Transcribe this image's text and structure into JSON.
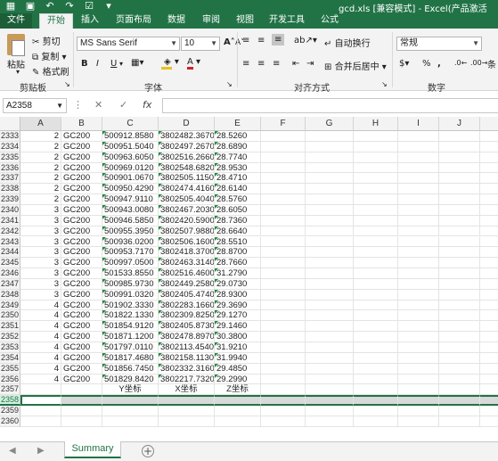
{
  "window": {
    "title": "gcd.xls  [兼容模式] - Excel(产品激活"
  },
  "qat": {
    "save_icon": "save-icon",
    "undo_icon": "undo-icon",
    "redo_icon": "redo-icon"
  },
  "tabs": [
    {
      "label": "文件"
    },
    {
      "label": "开始"
    },
    {
      "label": "插入"
    },
    {
      "label": "页面布局"
    },
    {
      "label": "数据"
    },
    {
      "label": "审阅"
    },
    {
      "label": "视图"
    },
    {
      "label": "开发工具"
    },
    {
      "label": "公式"
    }
  ],
  "ribbon": {
    "clipboard": {
      "paste": "粘贴",
      "cut": "剪切",
      "copy": "复制",
      "format_painter": "格式刷",
      "label": "剪贴板"
    },
    "font": {
      "name": "MS Sans Serif",
      "size": "10",
      "bold": "B",
      "italic": "I",
      "underline": "U",
      "grow": "A",
      "shrink": "A",
      "color_letter": "A",
      "label": "字体",
      "accent_color": "#e8c31b",
      "font_color": "#d0202a"
    },
    "alignment": {
      "wrap": "自动换行",
      "merge": "合并后居中",
      "label": "对齐方式"
    },
    "number": {
      "format": "常规",
      "percent": "%",
      "comma": ",",
      "label": "数字",
      "more": "条"
    }
  },
  "formula_bar": {
    "cell_ref": "A2358",
    "cancel": "✕",
    "enter": "✓",
    "fx": "fx",
    "value": ""
  },
  "columns": [
    "A",
    "B",
    "C",
    "D",
    "E",
    "F",
    "G",
    "H",
    "I",
    "J"
  ],
  "rows": [
    {
      "n": "2333",
      "a": "2",
      "b": "GC200",
      "c": "500912.8580",
      "d": "3802482.3670",
      "e": "28.5260"
    },
    {
      "n": "2334",
      "a": "2",
      "b": "GC200",
      "c": "500951.5040",
      "d": "3802497.2670",
      "e": "28.6890"
    },
    {
      "n": "2335",
      "a": "2",
      "b": "GC200",
      "c": "500963.6050",
      "d": "3802516.2660",
      "e": "28.7740"
    },
    {
      "n": "2336",
      "a": "2",
      "b": "GC200",
      "c": "500969.0120",
      "d": "3802548.6820",
      "e": "28.9530"
    },
    {
      "n": "2337",
      "a": "2",
      "b": "GC200",
      "c": "500901.0670",
      "d": "3802505.1150",
      "e": "28.4710"
    },
    {
      "n": "2338",
      "a": "2",
      "b": "GC200",
      "c": "500950.4290",
      "d": "3802474.4160",
      "e": "28.6140"
    },
    {
      "n": "2339",
      "a": "2",
      "b": "GC200",
      "c": "500947.9110",
      "d": "3802505.4040",
      "e": "28.5760"
    },
    {
      "n": "2340",
      "a": "3",
      "b": "GC200",
      "c": "500943.0080",
      "d": "3802467.2030",
      "e": "28.6050"
    },
    {
      "n": "2341",
      "a": "3",
      "b": "GC200",
      "c": "500946.5850",
      "d": "3802420.5900",
      "e": "28.7360"
    },
    {
      "n": "2342",
      "a": "3",
      "b": "GC200",
      "c": "500955.3950",
      "d": "3802507.9880",
      "e": "28.6640"
    },
    {
      "n": "2343",
      "a": "3",
      "b": "GC200",
      "c": "500936.0200",
      "d": "3802506.1600",
      "e": "28.5510"
    },
    {
      "n": "2344",
      "a": "3",
      "b": "GC200",
      "c": "500953.7170",
      "d": "3802418.3700",
      "e": "28.8700"
    },
    {
      "n": "2345",
      "a": "3",
      "b": "GC200",
      "c": "500997.0500",
      "d": "3802463.3140",
      "e": "28.7660"
    },
    {
      "n": "2346",
      "a": "3",
      "b": "GC200",
      "c": "501533.8550",
      "d": "3802516.4600",
      "e": "31.2790"
    },
    {
      "n": "2347",
      "a": "3",
      "b": "GC200",
      "c": "500985.9730",
      "d": "3802449.2580",
      "e": "29.0730"
    },
    {
      "n": "2348",
      "a": "3",
      "b": "GC200",
      "c": "500991.0320",
      "d": "3802405.4740",
      "e": "28.9300"
    },
    {
      "n": "2349",
      "a": "4",
      "b": "GC200",
      "c": "501902.3330",
      "d": "3802283.1660",
      "e": "29.3690"
    },
    {
      "n": "2350",
      "a": "4",
      "b": "GC200",
      "c": "501822.1330",
      "d": "3802309.8250",
      "e": "29.1270"
    },
    {
      "n": "2351",
      "a": "4",
      "b": "GC200",
      "c": "501854.9120",
      "d": "3802405.8730",
      "e": "29.1460"
    },
    {
      "n": "2352",
      "a": "4",
      "b": "GC200",
      "c": "501871.1200",
      "d": "3802478.8970",
      "e": "30.3800"
    },
    {
      "n": "2353",
      "a": "4",
      "b": "GC200",
      "c": "501797.0110",
      "d": "3802113.4540",
      "e": "31.9210"
    },
    {
      "n": "2354",
      "a": "4",
      "b": "GC200",
      "c": "501817.4680",
      "d": "3802158.1130",
      "e": "31.9940"
    },
    {
      "n": "2355",
      "a": "4",
      "b": "GC200",
      "c": "501856.7450",
      "d": "3802332.3160",
      "e": "29.4850"
    },
    {
      "n": "2356",
      "a": "4",
      "b": "GC200",
      "c": "501829.8420",
      "d": "3802217.7320",
      "e": "29.2990"
    },
    {
      "n": "2357",
      "a": "",
      "b": "",
      "c": "Y坐标",
      "d": "X坐标",
      "e": "Z坐标"
    },
    {
      "n": "2358",
      "a": "",
      "b": "",
      "c": "",
      "d": "",
      "e": ""
    },
    {
      "n": "2359",
      "a": "",
      "b": "",
      "c": "",
      "d": "",
      "e": ""
    },
    {
      "n": "2360",
      "a": "",
      "b": "",
      "c": "",
      "d": "",
      "e": ""
    }
  ],
  "selected_row": "2358",
  "sheet": {
    "tab": "Summary",
    "add": "+",
    "prev": "◀",
    "next": "▶"
  },
  "colors": {
    "brand": "#217346",
    "ribbon_bg": "#f3f3f3"
  }
}
